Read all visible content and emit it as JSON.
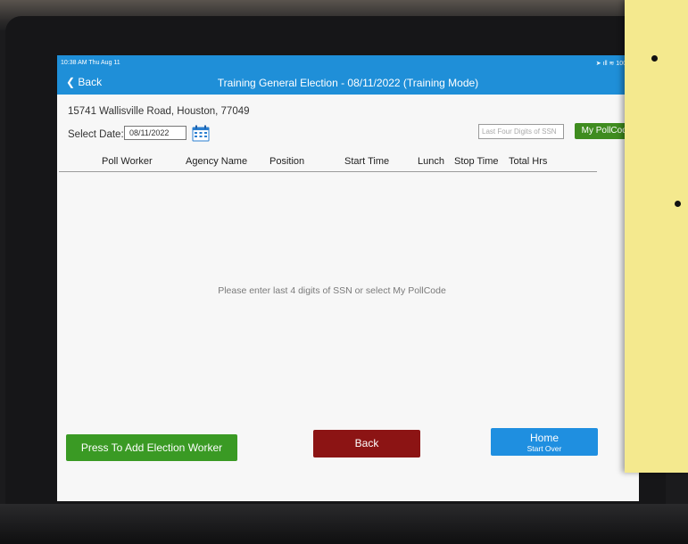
{
  "status_bar": {
    "time": "10:38 AM  Thu Aug 11",
    "icons": "➤ ıll ≋ 100"
  },
  "nav": {
    "back_label": "Back",
    "title": "Training General Election - 08/11/2022 (Training Mode)"
  },
  "location": {
    "address": "15741 Wallisville Road, Houston, 77049"
  },
  "date_select": {
    "label": "Select Date:",
    "value": "08/11/2022"
  },
  "ssn_search": {
    "placeholder": "Last Four Digits of SSN"
  },
  "my_pollcode_label": "My PollCode",
  "table": {
    "columns": [
      "Poll Worker",
      "Agency Name",
      "Position",
      "Start Time",
      "Lunch",
      "Stop Time",
      "Total  Hrs"
    ]
  },
  "empty_message": "Please enter last 4 digits of SSN or select My PollCode",
  "buttons": {
    "add_worker": "Press To Add Election Worker",
    "back": "Back",
    "home": "Home",
    "home_sub": "Start Over"
  },
  "colors": {
    "header_blue": "#1f8fd8",
    "add_green": "#3a9a24",
    "back_red": "#8c1414",
    "home_blue": "#1f8fe0"
  }
}
